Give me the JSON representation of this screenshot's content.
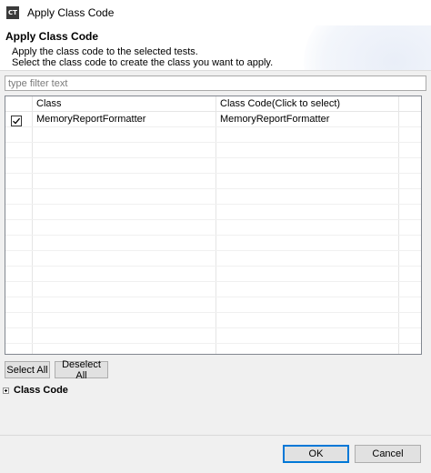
{
  "window": {
    "title": "Apply Class Code",
    "icon_text": "CT"
  },
  "header": {
    "title": "Apply Class Code",
    "line1": "Apply the class code to the selected tests.",
    "line2": "Select the class code to create the class you want to apply."
  },
  "filter": {
    "placeholder": "type filter text",
    "value": ""
  },
  "table": {
    "columns": [
      "",
      "Class",
      "Class Code(Click to select)"
    ],
    "rows": [
      {
        "checked": true,
        "class": "MemoryReportFormatter",
        "class_code": "MemoryReportFormatter"
      }
    ]
  },
  "buttons": {
    "select_all": "Select All",
    "deselect_all": "Deselect All",
    "ok": "OK",
    "cancel": "Cancel"
  },
  "section": {
    "title": "Class Code"
  },
  "colors": {
    "accent": "#0078d7",
    "button_bg": "#e1e1e1",
    "dialog_bg": "#f0f0f0"
  }
}
